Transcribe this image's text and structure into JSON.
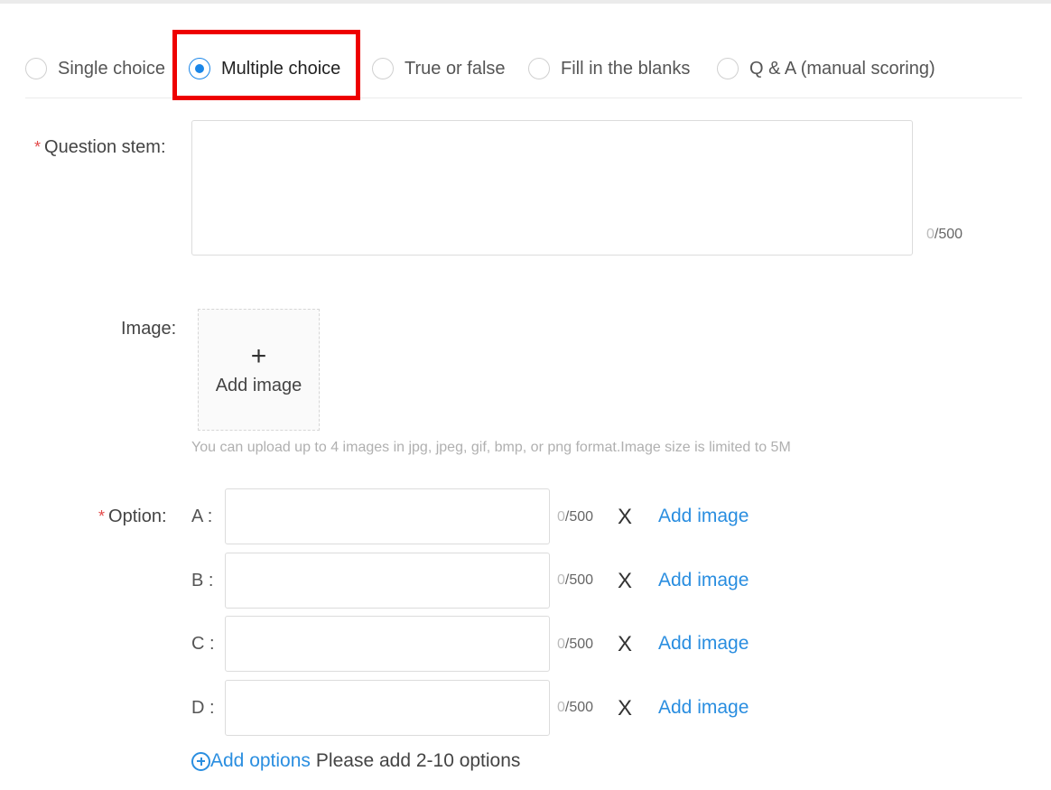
{
  "question_types": [
    {
      "label": "Single choice",
      "checked": false
    },
    {
      "label": "Multiple choice",
      "checked": true
    },
    {
      "label": "True or false",
      "checked": false
    },
    {
      "label": "Fill in the blanks",
      "checked": false
    },
    {
      "label": "Q & A (manual scoring)",
      "checked": false
    }
  ],
  "stem": {
    "label": "Question stem",
    "required_mark": "*",
    "colon": ":",
    "value": "",
    "count_current": "0",
    "count_max": "/500"
  },
  "image": {
    "label": "Image",
    "colon": ":",
    "upload_icon": "+",
    "upload_label": "Add image",
    "hint": "You can upload up to 4 images in jpg, jpeg, gif, bmp, or png format.Image size is limited to 5M"
  },
  "option": {
    "label": "Option",
    "required_mark": "*",
    "colon": ":",
    "items": [
      {
        "letter": "A :",
        "value": "",
        "count_current": "0",
        "count_max": "/500",
        "remove": "X",
        "add_image": "Add image"
      },
      {
        "letter": "B :",
        "value": "",
        "count_current": "0",
        "count_max": "/500",
        "remove": "X",
        "add_image": "Add image"
      },
      {
        "letter": "C :",
        "value": "",
        "count_current": "0",
        "count_max": "/500",
        "remove": "X",
        "add_image": "Add image"
      },
      {
        "letter": "D :",
        "value": "",
        "count_current": "0",
        "count_max": "/500",
        "remove": "X",
        "add_image": "Add image"
      }
    ]
  },
  "add_options": {
    "label": "Add options",
    "note": "Please add 2-10 options"
  },
  "colors": {
    "accent": "#1a86e8",
    "link": "#2a8ee0",
    "highlight": "#ee0000",
    "required": "#e34a4a"
  }
}
